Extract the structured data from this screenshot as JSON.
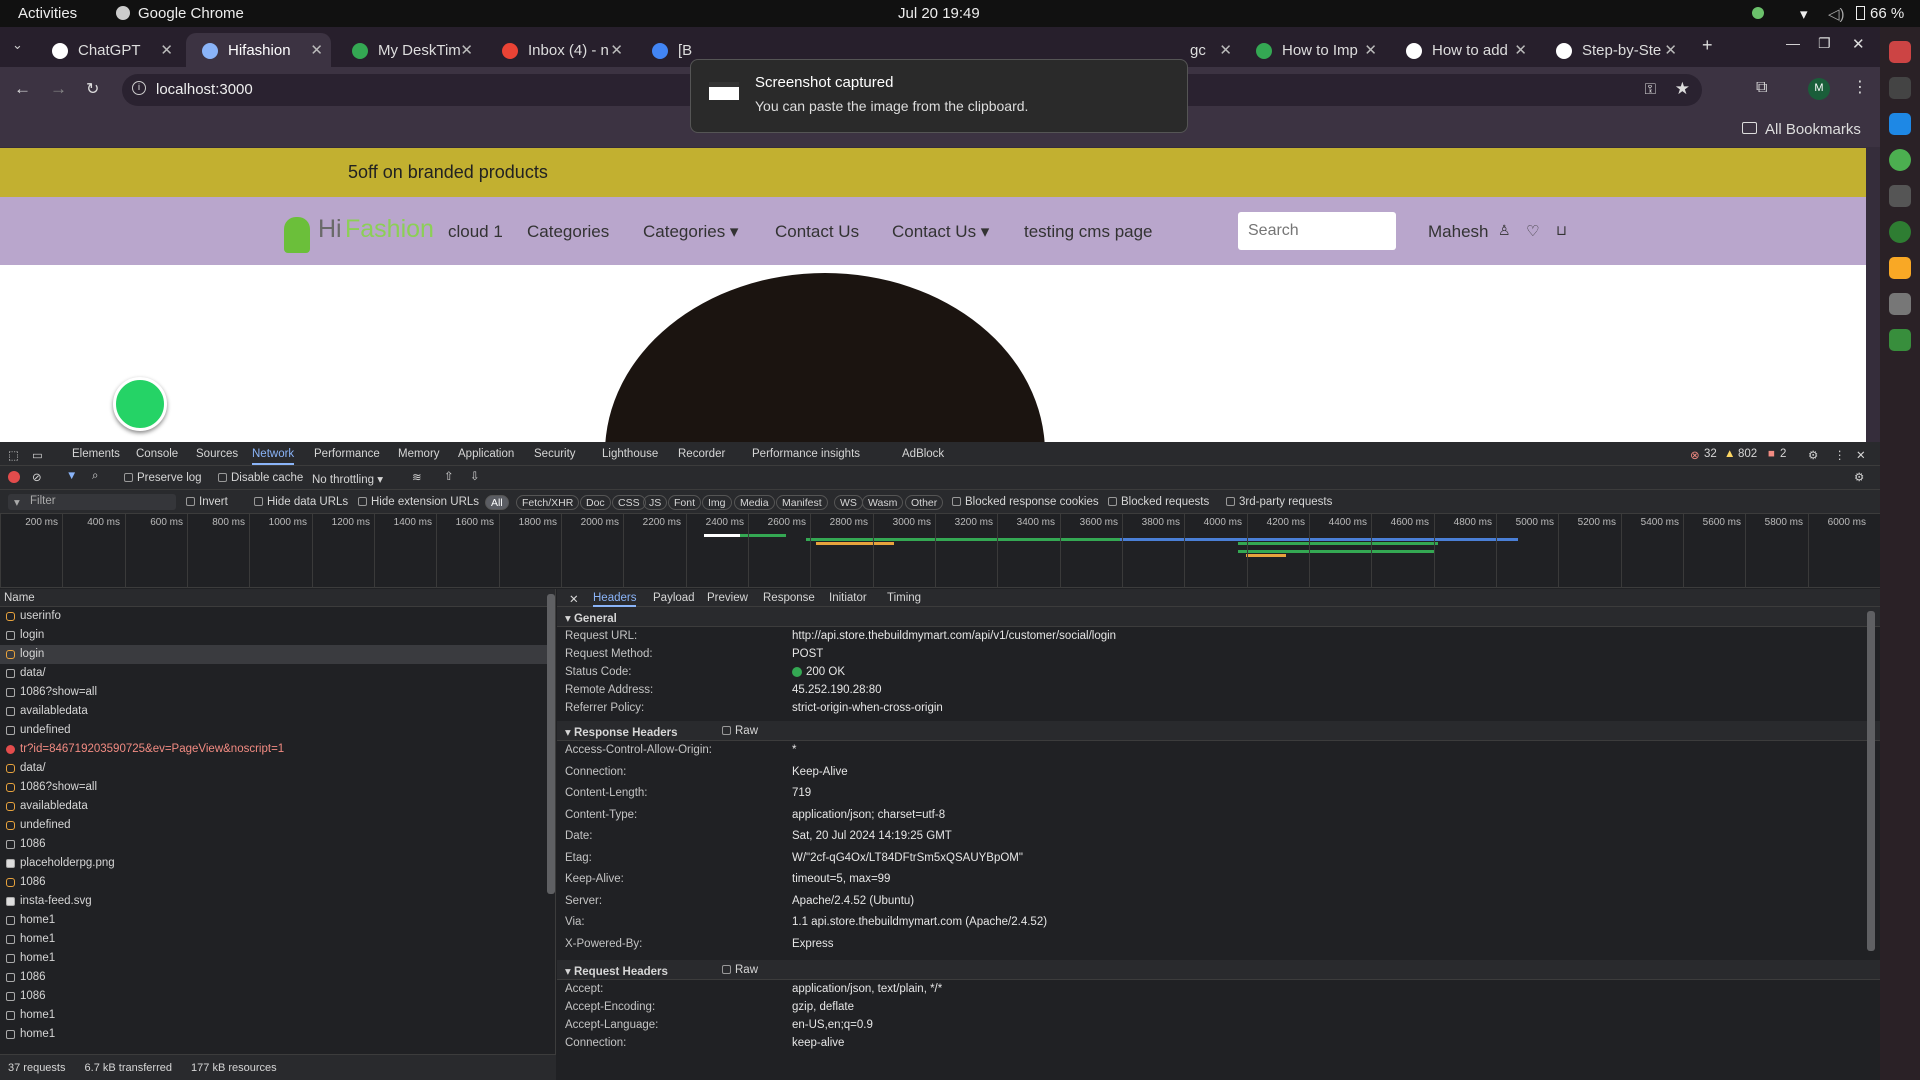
{
  "system": {
    "activities": "Activities",
    "app": "Google Chrome",
    "clock": "Jul 20  19:49",
    "battery": "66 %"
  },
  "tabs": [
    {
      "label": "ChatGPT",
      "color": "#ffffff"
    },
    {
      "label": "Hifashion",
      "color": "#8ab4f8"
    },
    {
      "label": "My DeskTim",
      "color": "#34a853"
    },
    {
      "label": "Inbox (4) - n",
      "color": "#ea4335"
    },
    {
      "label": "[B",
      "color": "#4285f4"
    },
    {
      "label": "gc",
      "color": "#666666"
    },
    {
      "label": "How to Imp",
      "color": "#34a853"
    },
    {
      "label": "How to add",
      "color": "#ffffff"
    },
    {
      "label": "Step-by-Ste",
      "color": "#ffffff"
    }
  ],
  "toolbar": {
    "url": "localhost:3000",
    "bookmarks_label": "All Bookmarks",
    "profile_initial": "M"
  },
  "toast": {
    "title": "Screenshot captured",
    "message": "You can paste the image from the clipboard."
  },
  "site": {
    "banner_text": "5off on branded products",
    "logo_hi": "Hi",
    "logo_fashion": "Fashion",
    "nav": [
      "cloud 1",
      "Categories",
      "Categories ▾",
      "Contact Us",
      "Contact Us ▾",
      "testing cms page"
    ],
    "search_placeholder": "Search",
    "user_name": "Mahesh"
  },
  "devtools": {
    "tabs": [
      "Elements",
      "Console",
      "Sources",
      "Network",
      "Performance",
      "Memory",
      "Application",
      "Security",
      "Lighthouse",
      "Recorder",
      "Performance insights",
      "AdBlock"
    ],
    "active_tab": "Network",
    "errors": "32",
    "warnings": "802",
    "issues": "2",
    "preserve_log": "Preserve log",
    "disable_cache": "Disable cache",
    "throttling": "No throttling",
    "filter_placeholder": "Filter",
    "invert": "Invert",
    "hide_data_urls": "Hide data URLs",
    "hide_extension_urls": "Hide extension URLs",
    "type_filters": [
      "All",
      "Fetch/XHR",
      "Doc",
      "CSS",
      "JS",
      "Font",
      "Img",
      "Media",
      "Manifest",
      "WS",
      "Wasm",
      "Other"
    ],
    "blocked_cookies": "Blocked response cookies",
    "blocked_requests": "Blocked requests",
    "third_party": "3rd-party requests",
    "timeline_ticks": [
      "200 ms",
      "400 ms",
      "600 ms",
      "800 ms",
      "1000 ms",
      "1200 ms",
      "1400 ms",
      "1600 ms",
      "1800 ms",
      "2000 ms",
      "2200 ms",
      "2400 ms",
      "2600 ms",
      "2800 ms",
      "3000 ms",
      "3200 ms",
      "3400 ms",
      "3600 ms",
      "3800 ms",
      "4000 ms",
      "4200 ms",
      "4400 ms",
      "4600 ms",
      "4800 ms",
      "5000 ms",
      "5200 ms",
      "5400 ms",
      "5600 ms",
      "5800 ms",
      "6000 ms"
    ],
    "name_header": "Name",
    "requests": [
      {
        "name": "userinfo",
        "kind": "x"
      },
      {
        "name": "login",
        "kind": "doc"
      },
      {
        "name": "login",
        "kind": "x",
        "selected": true
      },
      {
        "name": "data/",
        "kind": "doc"
      },
      {
        "name": "1086?show=all",
        "kind": "doc"
      },
      {
        "name": "availabledata",
        "kind": "doc"
      },
      {
        "name": "undefined",
        "kind": "doc"
      },
      {
        "name": "tr?id=846719203590725&ev=PageView&noscript=1",
        "kind": "error"
      },
      {
        "name": "data/",
        "kind": "x"
      },
      {
        "name": "1086?show=all",
        "kind": "x"
      },
      {
        "name": "availabledata",
        "kind": "x"
      },
      {
        "name": "undefined",
        "kind": "x"
      },
      {
        "name": "1086",
        "kind": "doc"
      },
      {
        "name": "placeholderpg.png",
        "kind": "img"
      },
      {
        "name": "1086",
        "kind": "x"
      },
      {
        "name": "insta-feed.svg",
        "kind": "img"
      },
      {
        "name": "home1",
        "kind": "doc"
      },
      {
        "name": "home1",
        "kind": "doc"
      },
      {
        "name": "home1",
        "kind": "doc"
      },
      {
        "name": "1086",
        "kind": "doc"
      },
      {
        "name": "1086",
        "kind": "doc"
      },
      {
        "name": "home1",
        "kind": "doc"
      },
      {
        "name": "home1",
        "kind": "doc"
      }
    ],
    "summary": {
      "requests": "37 requests",
      "transferred": "6.7 kB transferred",
      "resources": "177 kB resources"
    },
    "detail_tabs": [
      "Headers",
      "Payload",
      "Preview",
      "Response",
      "Initiator",
      "Timing"
    ],
    "active_detail_tab": "Headers",
    "general_title": "General",
    "general": [
      {
        "k": "Request URL:",
        "v": "http://api.store.thebuildmymart.com/api/v1/customer/social/login"
      },
      {
        "k": "Request Method:",
        "v": "POST"
      },
      {
        "k": "Status Code:",
        "v": "200 OK"
      },
      {
        "k": "Remote Address:",
        "v": "45.252.190.28:80"
      },
      {
        "k": "Referrer Policy:",
        "v": "strict-origin-when-cross-origin"
      }
    ],
    "response_title": "Response Headers",
    "raw_label": "Raw",
    "response_headers": [
      {
        "k": "Access-Control-Allow-Origin:",
        "v": "*"
      },
      {
        "k": "Connection:",
        "v": "Keep-Alive"
      },
      {
        "k": "Content-Length:",
        "v": "719"
      },
      {
        "k": "Content-Type:",
        "v": "application/json; charset=utf-8"
      },
      {
        "k": "Date:",
        "v": "Sat, 20 Jul 2024 14:19:25 GMT"
      },
      {
        "k": "Etag:",
        "v": "W/\"2cf-qG4Ox/LT84DFtrSm5xQSAUYBpOM\""
      },
      {
        "k": "Keep-Alive:",
        "v": "timeout=5, max=99"
      },
      {
        "k": "Server:",
        "v": "Apache/2.4.52 (Ubuntu)"
      },
      {
        "k": "Via:",
        "v": "1.1 api.store.thebuildmymart.com (Apache/2.4.52)"
      },
      {
        "k": "X-Powered-By:",
        "v": "Express"
      }
    ],
    "request_title": "Request Headers",
    "request_headers": [
      {
        "k": "Accept:",
        "v": "application/json, text/plain, */*"
      },
      {
        "k": "Accept-Encoding:",
        "v": "gzip, deflate"
      },
      {
        "k": "Accept-Language:",
        "v": "en-US,en;q=0.9"
      },
      {
        "k": "Connection:",
        "v": "keep-alive"
      }
    ]
  }
}
